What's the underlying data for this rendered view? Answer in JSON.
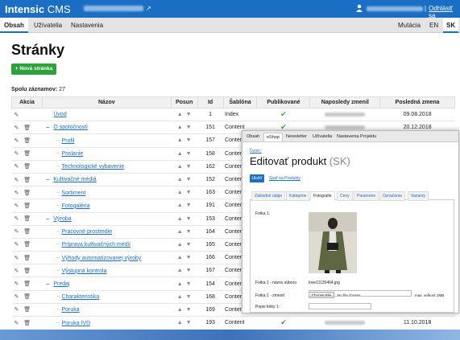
{
  "app": {
    "brand_bold": "Intensic",
    "brand_rest": " CMS",
    "logout": "Odhlásiť sa",
    "sep": "|"
  },
  "nav": {
    "tabs": [
      "Obsah",
      "Užívatelia",
      "Nastavenia"
    ],
    "right": [
      "Mutácia",
      "EN",
      "SK"
    ]
  },
  "page": {
    "title": "Stránky",
    "new_button": "+ Nová stránka",
    "total_label": "Spolu záznamov:",
    "total_value": "27"
  },
  "table": {
    "headers": [
      "Akcia",
      "Názov",
      "Posun",
      "Id",
      "Šablóna",
      "Publikované",
      "Naposledy zmenil",
      "Posledná zmena"
    ],
    "rows": [
      {
        "name": "Úvod",
        "level": 0,
        "tree": "",
        "id": "1",
        "tpl": "Index",
        "pub": "✔",
        "date": "09.08.2018"
      },
      {
        "name": "O spoločnosti",
        "level": 0,
        "tree": "–",
        "id": "151",
        "tpl": "Content",
        "pub": "✔",
        "date": "20.12.2018"
      },
      {
        "name": "Profil",
        "level": 1,
        "tree": "",
        "id": "157",
        "tpl": "Content",
        "pub": "",
        "date": ""
      },
      {
        "name": "Poslanie",
        "level": 1,
        "tree": "",
        "id": "158",
        "tpl": "Content",
        "pub": "",
        "date": ""
      },
      {
        "name": "Technologické vybavenie",
        "level": 1,
        "tree": "",
        "id": "162",
        "tpl": "Content",
        "pub": "",
        "date": ""
      },
      {
        "name": "Kultivačné médiá",
        "level": 0,
        "tree": "–",
        "id": "152",
        "tpl": "Content",
        "pub": "",
        "date": ""
      },
      {
        "name": "Sortiment",
        "level": 1,
        "tree": "",
        "id": "163",
        "tpl": "Content",
        "pub": "",
        "date": ""
      },
      {
        "name": "Fotogaléria",
        "level": 1,
        "tree": "",
        "id": "191",
        "tpl": "Content",
        "pub": "",
        "date": ""
      },
      {
        "name": "Výroba",
        "level": 0,
        "tree": "–",
        "id": "153",
        "tpl": "Content",
        "pub": "",
        "date": ""
      },
      {
        "name": "Pracovné prostredie",
        "level": 1,
        "tree": "",
        "id": "164",
        "tpl": "Content",
        "pub": "",
        "date": ""
      },
      {
        "name": "Príprava kultivačných médií",
        "level": 1,
        "tree": "",
        "id": "165",
        "tpl": "Content",
        "pub": "",
        "date": ""
      },
      {
        "name": "Výhody automatizovanej výroby",
        "level": 1,
        "tree": "",
        "id": "166",
        "tpl": "Content",
        "pub": "",
        "date": ""
      },
      {
        "name": "Výstupná kontrola",
        "level": 1,
        "tree": "",
        "id": "167",
        "tpl": "Content",
        "pub": "",
        "date": ""
      },
      {
        "name": "Predaj",
        "level": 0,
        "tree": "–",
        "id": "154",
        "tpl": "Content",
        "pub": "",
        "date": ""
      },
      {
        "name": "Charakteristika",
        "level": 1,
        "tree": "",
        "id": "168",
        "tpl": "Content",
        "pub": "",
        "date": ""
      },
      {
        "name": "Poruka",
        "level": 1,
        "tree": "",
        "id": "169",
        "tpl": "Content",
        "pub": "",
        "date": ""
      },
      {
        "name": "Poruka IVD",
        "level": 1,
        "tree": "",
        "id": "193",
        "tpl": "Content",
        "pub": "✔",
        "date": "11.10.2018"
      }
    ]
  },
  "overlay": {
    "tabs": [
      "Obsah",
      "eShop",
      "Newsletter",
      "Užívatelia",
      "Nastavenia Projektu"
    ],
    "crumb": "Úvod ›",
    "title": "Editovať produkt",
    "title_lang": "(SK)",
    "save": "Uložiť",
    "back": "Späť na Produkty",
    "subtabs": [
      "Základné údaje",
      "Kategórie",
      "Fotografie",
      "Ceny",
      "Parametre",
      "Označenia",
      "Varianty"
    ],
    "photo_label": "Fotka 1:",
    "file_name_label": "Fotka 1 - názov súboru",
    "file_name": "love11135464.jpg",
    "change_label": "Fotka 1 - zmeniť",
    "choose_file": "Choose File",
    "no_file": "No file chosen",
    "max_size": "max. veľkosť 2MB",
    "desc_label": "Popis fotky 1:"
  },
  "colors": {
    "accent": "#1a6fc4",
    "success": "#2ba23a"
  }
}
